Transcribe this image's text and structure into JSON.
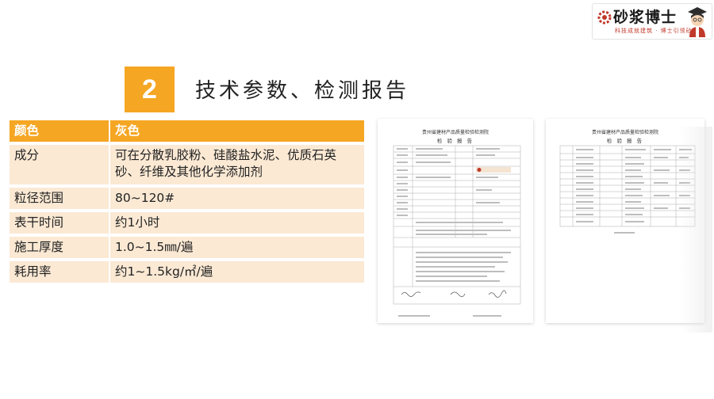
{
  "logo": {
    "brand": "砂浆博士",
    "slogan": "科技成就建筑 · 博士引领砂浆",
    "icon": "gear-logo-icon",
    "mascot": "doctor-mascot-icon",
    "accent": "#c0392b"
  },
  "section": {
    "number": "2",
    "title": "技术参数、检测报告",
    "accent": "#f5a623"
  },
  "spec_table": {
    "header": {
      "label": "颜色",
      "value": "灰色"
    },
    "rows": [
      {
        "label": "成分",
        "value": "可在分散乳胶粉、硅酸盐水泥、优质石英砂、纤维及其他化学添加剂"
      },
      {
        "label": "粒径范围",
        "value": "80~120#"
      },
      {
        "label": "表干时间",
        "value": "约1小时"
      },
      {
        "label": "施工厚度",
        "value": "1.0~1.5㎜/遍"
      },
      {
        "label": "耗用率",
        "value": "约1~1.5kg/㎡/遍"
      }
    ],
    "row_color": "#fbe9d4"
  },
  "reports": [
    {
      "title": "贵州省建材产品质量检验检测院",
      "subtitle": "检 验 报 告"
    },
    {
      "title": "贵州省建材产品质量检验检测院",
      "subtitle": "检 验 报 告"
    }
  ]
}
